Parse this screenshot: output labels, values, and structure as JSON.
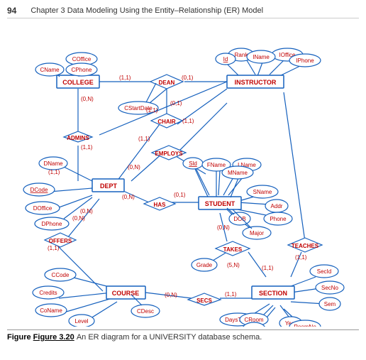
{
  "header": {
    "page_number": "94",
    "chapter_title": "Chapter 3  Data Modeling Using the Entity–Relationship (ER) Model"
  },
  "figure": {
    "label": "Figure 3.20",
    "caption": "An ER diagram for a UNIVERSITY database schema."
  },
  "colors": {
    "entity_fill": "#fff",
    "entity_border": "#0070c0",
    "entity_text": "#c00000",
    "attr_fill": "#fff",
    "attr_border": "#0070c0",
    "attr_text": "#c00000",
    "relation_fill": "#fff",
    "relation_border": "#0070c0",
    "relation_text": "#c00000",
    "line_color": "#0070c0",
    "cardinality_text": "#c00000"
  }
}
